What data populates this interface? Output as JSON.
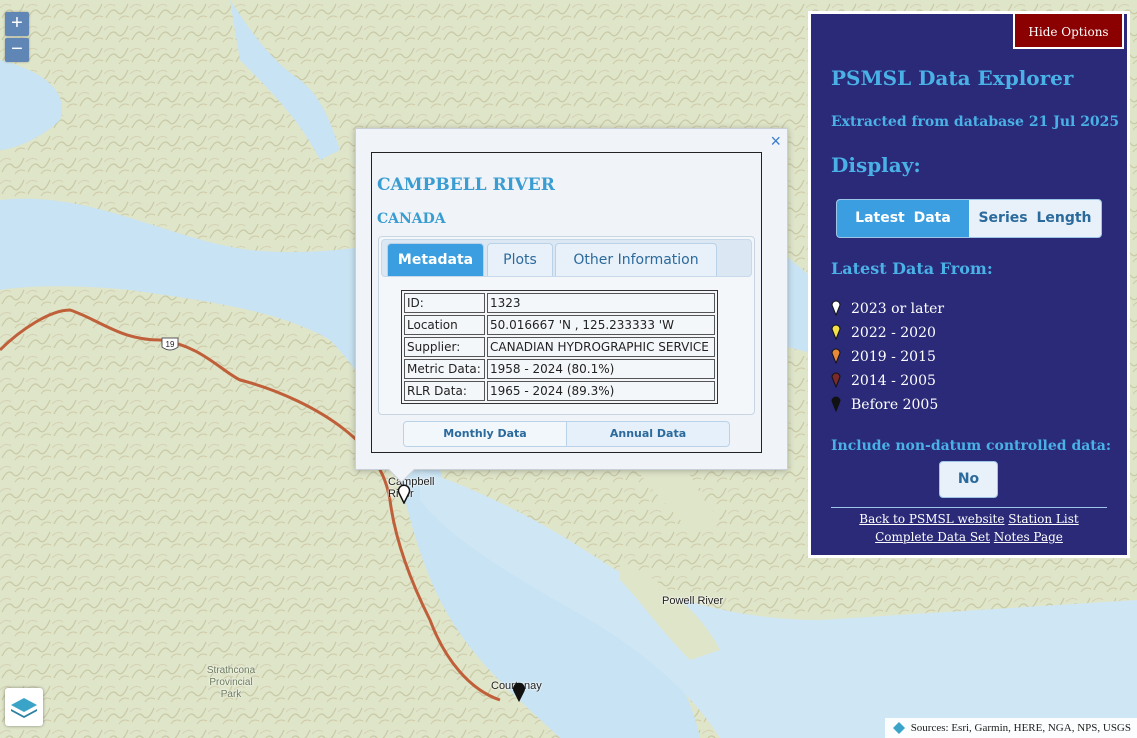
{
  "map": {
    "zoom_in": "+",
    "zoom_out": "−",
    "places": [
      "Campbell River",
      "Powell River",
      "Courtenay",
      "Strathcona Provincial Park"
    ],
    "highway_shield": "19",
    "attribution": "Sources: Esri, Garmin, HERE, NGA, NPS, USGS",
    "colors": {
      "land": "#dfe8cf",
      "water": "#c8e3f3",
      "highway": "#c0603a"
    }
  },
  "popup": {
    "close": "×",
    "station_name": "CAMPBELL RIVER",
    "country": "CANADA",
    "tabs": [
      {
        "label": "Metadata",
        "active": true
      },
      {
        "label": "Plots",
        "active": false
      },
      {
        "label": "Other Information",
        "active": false
      }
    ],
    "metadata": [
      {
        "label": "ID:",
        "value": "1323"
      },
      {
        "label": "Location",
        "value": "50.016667 'N , 125.233333 'W"
      },
      {
        "label": "Supplier:",
        "value": "CANADIAN HYDROGRAPHIC SERVICE"
      },
      {
        "label": "Metric Data:",
        "value": "1958 - 2024 (80.1%)"
      },
      {
        "label": "RLR Data:",
        "value": "1965 - 2024 (89.3%)"
      }
    ],
    "buttons": {
      "monthly": "Monthly Data",
      "annual": "Annual Data"
    }
  },
  "panel": {
    "hide_options": "Hide Options",
    "title": "PSMSL Data Explorer",
    "extracted": "Extracted from database 21 Jul 2025",
    "display_heading": "Display:",
    "display_options": {
      "latest": "Latest Data",
      "series": "Series Length"
    },
    "latest_from_heading": "Latest Data From:",
    "legend": [
      {
        "label": "2023 or later",
        "color": "#ffffff"
      },
      {
        "label": "2022 - 2020",
        "color": "#f4e04a"
      },
      {
        "label": "2019 - 2015",
        "color": "#e8893a"
      },
      {
        "label": "2014 - 2005",
        "color": "#7a2a2a"
      },
      {
        "label": "Before 2005",
        "color": "#111111"
      }
    ],
    "non_datum_heading": "Include non-datum controlled data:",
    "non_datum_value": "No",
    "links": {
      "back": "Back to PSMSL website",
      "station_list": "Station List",
      "complete": "Complete Data Set",
      "notes": "Notes Page"
    },
    "colors": {
      "background": "#2a2a78",
      "heading": "#4ab1e6",
      "hide_button": "#8b0000",
      "selected": "#3a9ee0"
    }
  }
}
